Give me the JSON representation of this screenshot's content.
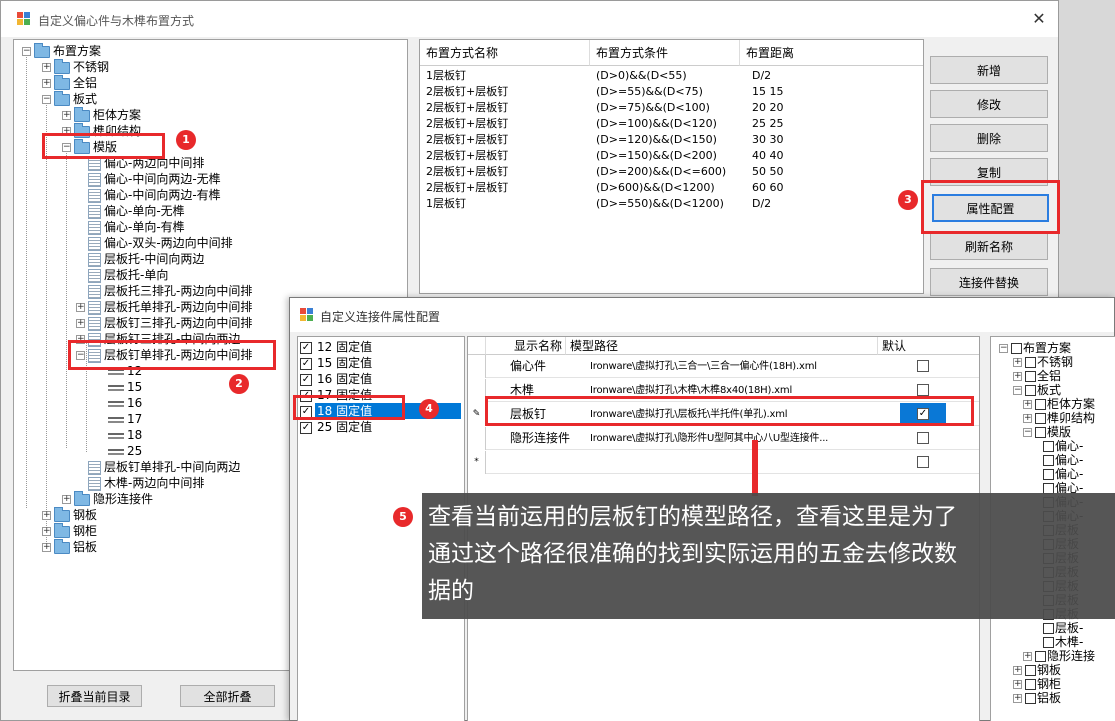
{
  "main_window": {
    "title": "自定义偏心件与木榫布置方式",
    "close_glyph": "✕",
    "tree": {
      "root": "布置方案",
      "items": [
        "不锈钢",
        "全铝",
        "板式",
        "柜体方案",
        "榫卯结构",
        "模版",
        "偏心-两边向中间排",
        "偏心-中间向两边-无榫",
        "偏心-中间向两边-有榫",
        "偏心-单向-无榫",
        "偏心-单向-有榫",
        "偏心-双头-两边向中间排",
        "层板托-中间向两边",
        "层板托-单向",
        "层板托三排孔-两边向中间排",
        "层板托单排孔-两边向中间排",
        "层板钉三排孔-两边向中间排",
        "层板钉三排孔-中间向两边",
        "层板钉单排孔-两边向中间排",
        "12",
        "15",
        "16",
        "17",
        "18",
        "25",
        "层板钉单排孔-中间向两边",
        "木榫-两边向中间排",
        "隐形连接件",
        "钢板",
        "钢柜",
        "铝板"
      ]
    },
    "buttons": {
      "collapse_current": "折叠当前目录",
      "collapse_all": "全部折叠",
      "add": "新增",
      "edit": "修改",
      "delete": "删除",
      "copy": "复制",
      "property_config": "属性配置",
      "refresh_name": "刷新名称",
      "connector_replace": "连接件替换"
    },
    "grid": {
      "headers": [
        "布置方式名称",
        "布置方式条件",
        "布置距离"
      ],
      "rows": [
        [
          "1层板钉",
          "(D>0)&&(D<55)",
          "D/2"
        ],
        [
          "2层板钉+层板钉",
          "(D>=55)&&(D<75)",
          "15 15"
        ],
        [
          "2层板钉+层板钉",
          "(D>=75)&&(D<100)",
          "20 20"
        ],
        [
          "2层板钉+层板钉",
          "(D>=100)&&(D<120)",
          "25 25"
        ],
        [
          "2层板钉+层板钉",
          "(D>=120)&&(D<150)",
          "30 30"
        ],
        [
          "2层板钉+层板钉",
          "(D>=150)&&(D<200)",
          "40 40"
        ],
        [
          "2层板钉+层板钉",
          "(D>=200)&&(D<=600)",
          "50 50"
        ],
        [
          "2层板钉+层板钉",
          "(D>600)&&(D<1200)",
          "60 60"
        ],
        [
          "1层板钉",
          "(D>=550)&&(D<1200)",
          "D/2"
        ]
      ]
    }
  },
  "dialog": {
    "title": "自定义连接件属性配置",
    "checklist": [
      {
        "num": "12",
        "label": "固定值",
        "checked": true
      },
      {
        "num": "15",
        "label": "固定值",
        "checked": true
      },
      {
        "num": "16",
        "label": "固定值",
        "checked": true
      },
      {
        "num": "17",
        "label": "固定值",
        "checked": true
      },
      {
        "num": "18",
        "label": "固定值",
        "checked": true
      },
      {
        "num": "25",
        "label": "固定值",
        "checked": true
      }
    ],
    "grid": {
      "headers": [
        "显示名称",
        "模型路径",
        "默认"
      ],
      "rows": [
        {
          "name": "偏心件",
          "path": "Ironware\\虚拟打孔\\三合一\\三合一偏心件(18H).xml",
          "default": false
        },
        {
          "name": "木榫",
          "path": "Ironware\\虚拟打孔\\木榫\\木榫8x40(18H).xml",
          "default": false
        },
        {
          "name": "层板钉",
          "path": "Ironware\\虚拟打孔\\层板托\\半托件(单孔).xml",
          "default": true
        },
        {
          "name": "隐形连接件",
          "path": "Ironware\\虚拟打孔\\隐形件U型阿其中心八U型连接件...",
          "default": false
        }
      ],
      "new_row_marker": "*",
      "edit_row_marker": "✎"
    },
    "tree": {
      "root": "布置方案",
      "items": [
        "不锈钢",
        "全铝",
        "板式",
        "柜体方案",
        "榫卯结构",
        "模版",
        "偏心-",
        "偏心-",
        "偏心-",
        "偏心-",
        "偏心-",
        "偏心-",
        "层板",
        "层板",
        "层板",
        "层板",
        "层板",
        "层板",
        "层板",
        "层板-",
        "木榫-",
        "隐形连接",
        "钢板",
        "钢柜",
        "铝板"
      ]
    }
  },
  "annotations": {
    "markers": [
      "1",
      "2",
      "3",
      "4",
      "5"
    ],
    "tooltip_lines": [
      "查看当前运用的层板钉的模型路径，查看这里是为了",
      "通过这个路径很准确的找到实际运用的五金去修改数",
      "据的"
    ],
    "accent_color": "#e8292b"
  }
}
